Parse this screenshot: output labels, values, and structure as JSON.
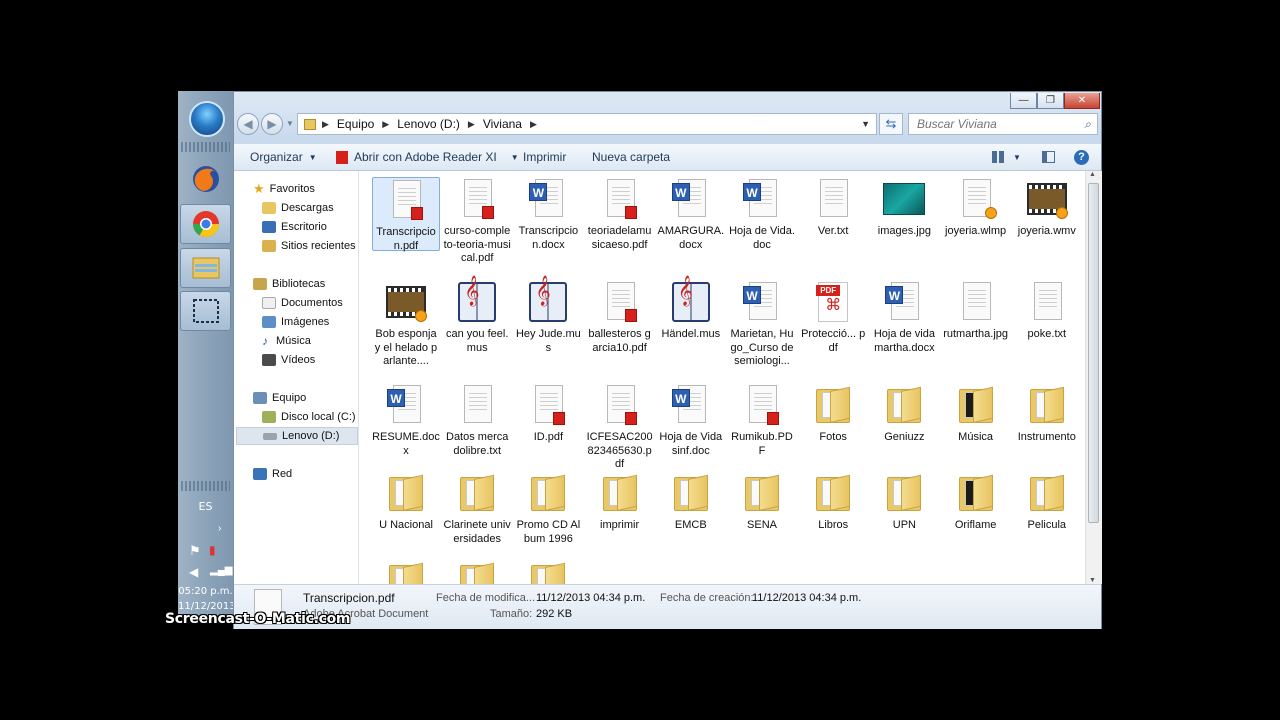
{
  "taskbar": {
    "language": "ES",
    "time": "05:20 p.m.",
    "date": "11/12/2013",
    "apps": [
      "start-orb-icon",
      "firefox-icon",
      "chrome-icon",
      "file-explorer-icon",
      "snipping-icon"
    ]
  },
  "window": {
    "controls": {
      "minimize": "—",
      "maximize": "❐",
      "close": "✕"
    },
    "address": {
      "segments": [
        "Equipo",
        "Lenovo (D:)",
        "Viviana"
      ]
    },
    "search": {
      "placeholder": "Buscar Viviana"
    },
    "toolbar": {
      "organize": "Organizar",
      "open_with": "Abrir con Adobe Reader XI",
      "print": "Imprimir",
      "new_folder": "Nueva carpeta"
    },
    "nav": {
      "favorites": "Favoritos",
      "downloads": "Descargas",
      "desktop": "Escritorio",
      "recent": "Sitios recientes",
      "libraries": "Bibliotecas",
      "documents": "Documentos",
      "images": "Imágenes",
      "music": "Música",
      "videos": "Vídeos",
      "computer": "Equipo",
      "local_disk": "Disco local (C:)",
      "lenovo": "Lenovo (D:)",
      "network": "Red"
    },
    "files": [
      {
        "name": "Transcripcion.pdf",
        "type": "pdf",
        "selected": true
      },
      {
        "name": "curso-completo-teoria-musical.pdf",
        "type": "pdf"
      },
      {
        "name": "Transcripcion.docx",
        "type": "word"
      },
      {
        "name": "teoriadelamusicaeso.pdf",
        "type": "pdf"
      },
      {
        "name": "AMARGURA.docx",
        "type": "word"
      },
      {
        "name": "Hoja de Vida.doc",
        "type": "word"
      },
      {
        "name": "Ver.txt",
        "type": "txt"
      },
      {
        "name": "images.jpg",
        "type": "image"
      },
      {
        "name": "joyeria.wlmp",
        "type": "wlmp"
      },
      {
        "name": "joyeria.wmv",
        "type": "video"
      },
      {
        "name": "Bob esponja y el helado parlante....",
        "type": "video"
      },
      {
        "name": "can you feel.mus",
        "type": "mus"
      },
      {
        "name": "Hey Jude.mus",
        "type": "mus"
      },
      {
        "name": "ballesteros garcia10.pdf",
        "type": "pdf"
      },
      {
        "name": "Händel.mus",
        "type": "mus"
      },
      {
        "name": "Marietan, Hugo_Curso de semiologi...",
        "type": "word"
      },
      {
        "name": "Protecció... pdf",
        "type": "acrobat"
      },
      {
        "name": "Hoja de vida martha.docx",
        "type": "word"
      },
      {
        "name": "rutmartha.jpg",
        "type": "doc"
      },
      {
        "name": "poke.txt",
        "type": "txt"
      },
      {
        "name": "RESUME.docx",
        "type": "word"
      },
      {
        "name": "Datos mercadolibre.txt",
        "type": "txt"
      },
      {
        "name": "ID.pdf",
        "type": "pdf"
      },
      {
        "name": "ICFESAC200823465630.pdf",
        "type": "pdf"
      },
      {
        "name": "Hoja de Vida sinf.doc",
        "type": "word"
      },
      {
        "name": "Rumikub.PDF",
        "type": "pdf"
      },
      {
        "name": "Fotos",
        "type": "folder"
      },
      {
        "name": "Geniuzz",
        "type": "folder"
      },
      {
        "name": "Música",
        "type": "folder-dark"
      },
      {
        "name": "Instrumento",
        "type": "folder"
      },
      {
        "name": "U Nacional",
        "type": "folder"
      },
      {
        "name": "Clarinete universidades",
        "type": "folder"
      },
      {
        "name": "Promo CD Album 1996",
        "type": "folder"
      },
      {
        "name": "imprimir",
        "type": "folder"
      },
      {
        "name": "EMCB",
        "type": "folder"
      },
      {
        "name": "SENA",
        "type": "folder"
      },
      {
        "name": "Libros",
        "type": "folder"
      },
      {
        "name": "UPN",
        "type": "folder"
      },
      {
        "name": "Oriflame",
        "type": "folder-dark"
      },
      {
        "name": "Pelicula",
        "type": "folder"
      }
    ],
    "details": {
      "filename": "Transcripcion.pdf",
      "filetype": "Adobe Acrobat Document",
      "modified_label": "Fecha de modifica...",
      "modified_value": "11/12/2013 04:34 p.m.",
      "created_label": "Fecha de creación:",
      "created_value": "11/12/2013 04:34 p.m.",
      "size_label": "Tamaño:",
      "size_value": "292 KB"
    }
  },
  "watermark": "Screencast-O-Matic.com"
}
